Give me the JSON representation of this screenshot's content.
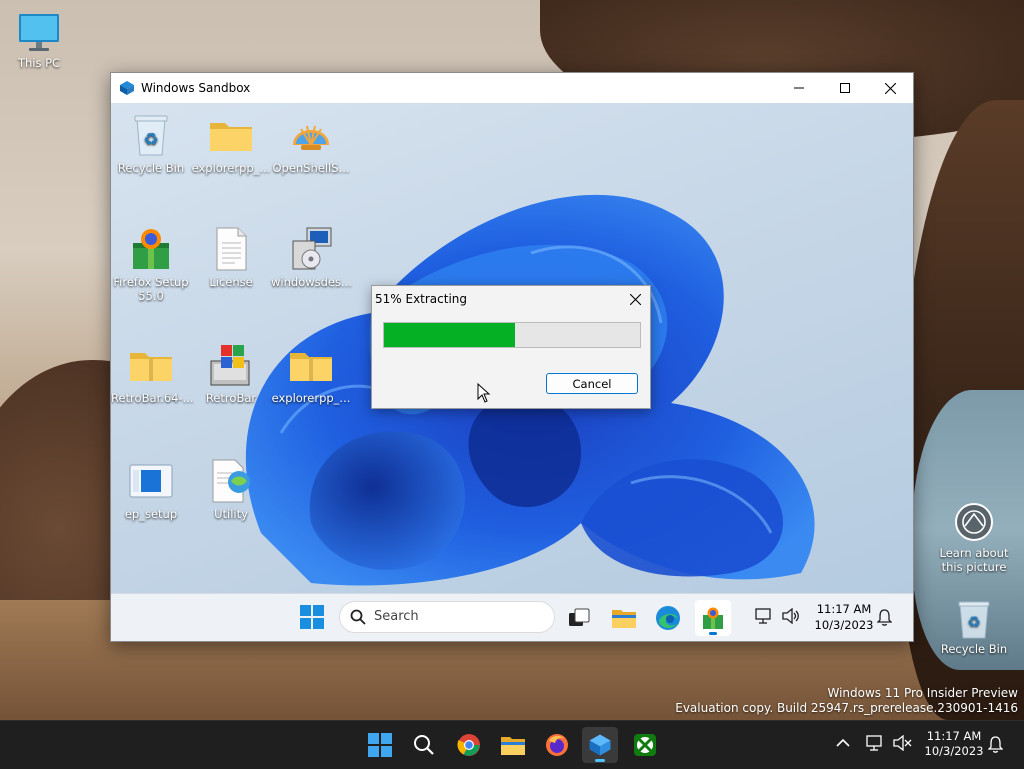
{
  "host": {
    "desktop_icons": [
      {
        "label": "This PC",
        "icon": "monitor-icon"
      },
      {
        "label": "Learn about this picture",
        "icon": "camera-info-icon"
      },
      {
        "label": "Recycle Bin",
        "icon": "recycle-bin-icon"
      }
    ],
    "watermark": {
      "line1": "Windows 11 Pro Insider Preview",
      "line2": "Evaluation copy. Build 25947.rs_prerelease.230901-1416"
    },
    "taskbar": {
      "apps": [
        "start-icon",
        "search-icon",
        "chrome-icon",
        "file-explorer-icon",
        "firefox-icon",
        "windows-sandbox-icon",
        "xbox-icon"
      ],
      "active_app": "windows-sandbox-icon",
      "time": "11:17 AM",
      "date": "10/3/2023"
    }
  },
  "sandbox": {
    "title": "Windows Sandbox",
    "desktop_icons": [
      {
        "label": "Recycle Bin",
        "icon": "recycle-bin-icon"
      },
      {
        "label": "explorerpp_...",
        "icon": "folder-zip-icon"
      },
      {
        "label": "OpenShellS...",
        "icon": "open-shell-icon"
      },
      {
        "label": "Firefox Setup 55.0",
        "icon": "firefox-setup-icon"
      },
      {
        "label": "License",
        "icon": "document-icon"
      },
      {
        "label": "windowsdes...",
        "icon": "installer-icon"
      },
      {
        "label": "RetroBar.64-...",
        "icon": "folder-zip-icon"
      },
      {
        "label": "RetroBar",
        "icon": "retrobar-icon"
      },
      {
        "label": "explorerpp_...",
        "icon": "folder-zip-icon"
      },
      {
        "label": "ep_setup",
        "icon": "ep-setup-icon"
      },
      {
        "label": "Utility",
        "icon": "utility-icon"
      }
    ],
    "taskbar": {
      "search_placeholder": "Search",
      "time": "11:17 AM",
      "date": "10/3/2023"
    }
  },
  "dialog": {
    "title": "51% Extracting",
    "progress_percent": 51,
    "cancel_label": "Cancel"
  },
  "colors": {
    "progress_fill": "#06b025",
    "accent": "#0078d4",
    "active_indicator": "#4cc2ff"
  }
}
